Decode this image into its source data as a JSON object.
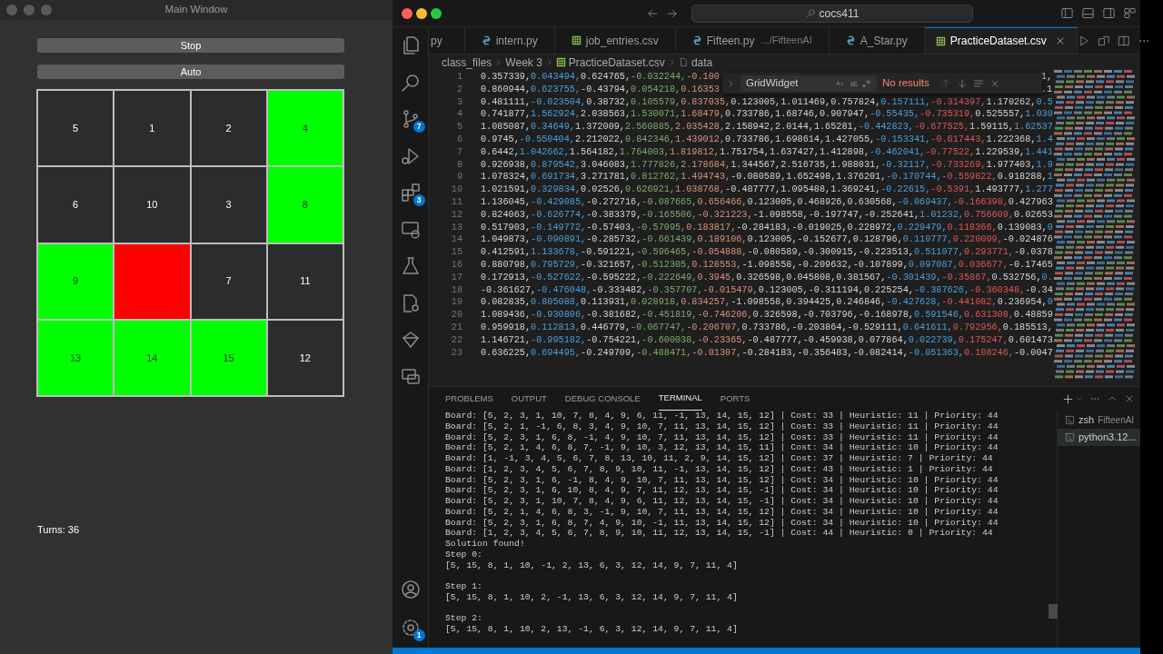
{
  "app_window": {
    "title": "Main Window",
    "buttons": [
      "Stop",
      "Auto"
    ],
    "tiles": [
      {
        "label": "5",
        "kind": "number"
      },
      {
        "label": "1",
        "kind": "number"
      },
      {
        "label": "2",
        "kind": "number"
      },
      {
        "label": "4",
        "kind": "correct"
      },
      {
        "label": "6",
        "kind": "number"
      },
      {
        "label": "10",
        "kind": "number"
      },
      {
        "label": "3",
        "kind": "number"
      },
      {
        "label": "8",
        "kind": "correct"
      },
      {
        "label": "9",
        "kind": "correct"
      },
      {
        "kind": "blank"
      },
      {
        "label": "7",
        "kind": "number"
      },
      {
        "label": "11",
        "kind": "number"
      },
      {
        "label": "13",
        "kind": "correct"
      },
      {
        "label": "14",
        "kind": "correct"
      },
      {
        "label": "15",
        "kind": "correct"
      },
      {
        "label": "12",
        "kind": "number"
      }
    ],
    "turns": "Turns: 36"
  },
  "editor_window": {
    "search": "cocs411",
    "activity_bar": {
      "source_control_badge": "7",
      "extensions_badge": "3",
      "manage_badge": "1"
    },
    "tabs": [
      {
        "label": "py",
        "kind": "cut",
        "selected": false
      },
      {
        "label": "intern.py",
        "kind": "python",
        "selected": false
      },
      {
        "label": "job_entries.csv",
        "kind": "csv",
        "selected": false
      },
      {
        "label": "Fifteen.py",
        "detail": ".../FifteenAI",
        "kind": "python",
        "selected": false
      },
      {
        "label": "A_Star.py",
        "kind": "python",
        "selected": false
      },
      {
        "label": "PracticeDataset.csv",
        "kind": "csv",
        "selected": true
      }
    ],
    "breadcrumb": [
      "class_files",
      "Week 3",
      "PracticeDataset.csv",
      "data"
    ],
    "find": {
      "value": "GridWidget",
      "result": "No results"
    },
    "lines": [
      {
        "number": "1",
        "text": "0.357339,0.043494,0.624765,-0.032244,-0.100",
        "tail": "1,"
      },
      {
        "number": "2",
        "text": "0.860944,0.623755,-0.43794,0.054218,0.16353",
        "tail": ".1"
      },
      {
        "number": "3",
        "text": "0.481111,-0.023504,0.38732,0.105579,0.837035,0.123005,1.011469,0.757824,0.157111,-0.314397,1.170262,0.5"
      },
      {
        "number": "4",
        "text": "0.741877,1.562924,2.038563,1.530071,1.68479,0.733786,1.68746,0.907947,-0.55435,-0.735319,0.525557,1.030"
      },
      {
        "number": "5",
        "text": "1.085087,0.34649,1.372009,2.560885,2.035428,2.158942,2.0144,1.65281,-0.442823,-0.677525,1.59115,1.62537"
      },
      {
        "number": "6",
        "text": "0.9745,-0.550404,2.212022,0.842346,1.439012,0.733786,1.698614,1.427055,-0.153341,-0.617443,1.222368,1.4"
      },
      {
        "number": "7",
        "text": "0.6442,1.042662,1.564182,1.764003,1.819812,1.751754,1.637427,1.412898,-0.462041,-0.77522,1.229539,1.441"
      },
      {
        "number": "8",
        "text": "0.926938,0.879542,3.046083,1.777826,2.178684,1.344567,2.516735,1.988031,-0.32117,-0.733269,1.977403,1.9"
      },
      {
        "number": "9",
        "text": "1.078324,0.691734,3.271781,0.812762,1.494743,-0.080589,1.652498,1.376201,-0.170744,-0.559822,0.918288,1"
      },
      {
        "number": "10",
        "text": "1.021591,0.329834,0.02526,0.626921,1.038768,-0.487777,1.095488,1.369241,-0.22615,-0.5391,1.493777,1.277"
      },
      {
        "number": "11",
        "text": "1.136045,-0.429085,-0.272716,-0.087665,0.656466,0.123005,0.468926,0.630568,-0.069437,-0.166398,0.427963"
      },
      {
        "number": "12",
        "text": "0.824063,-0.626774,-0.383379,-0.165506,-0.321223,-1.098558,-0.197747,-0.252641,1.01232,0.756609,0.02653"
      },
      {
        "number": "13",
        "text": "0.517903,-0.149772,-0.57403,-0.57095,0.183817,-0.284183,-0.019025,0.228972,0.229479,0.118366,0.139083,0"
      },
      {
        "number": "14",
        "text": "1.049873,-0.090891,-0.285732,-0.661439,0.189106,0.123005,-0.152677,0.128796,0.110777,0.220009,-0.024876"
      },
      {
        "number": "15",
        "text": "0.412591,1.133678,-0.591221,-0.596465,-0.054888,-0.080589,-0.300915,-0.223513,0.511077,0.293771,-0.0378"
      },
      {
        "number": "16",
        "text": "0.880798,0.795729,-0.321657,-0.512305,0.128553,-1.098558,-0.209632,-0.107899,0.097087,0.036677,-0.17465"
      },
      {
        "number": "17",
        "text": "0.172913,-0.527622,-0.595222,-0.222649,0.3945,0.326598,0.045808,0.381567,-0.301439,-0.35867,0.532756,0."
      },
      {
        "number": "18",
        "text": "-0.361627,-0.476048,-0.333482,-0.357707,-0.015479,0.123005,-0.311194,0.225254,-0.387626,-0.360348,-0.34"
      },
      {
        "number": "19",
        "text": "0.082835,0.805088,0.113931,0.028918,0.834257,-1.098558,0.394425,0.246846,-0.427628,-0.441082,0.236954,0"
      },
      {
        "number": "20",
        "text": "1.089436,-0.930806,-0.381682,-0.451819,-0.746206,0.326598,-0.703796,-0.168978,0.591546,0.631308,0.48859"
      },
      {
        "number": "21",
        "text": "0.959918,0.112813,0.446779,-0.067747,-0.206707,0.733786,-0.203864,-0.529111,0.641611,0.792956,0.185513,"
      },
      {
        "number": "22",
        "text": "1.146721,-0.995182,-0.754221,-0.600038,-0.23365,-0.487777,-0.459938,0.077864,0.022739,0.175247,0.601473"
      },
      {
        "number": "23",
        "text": "0.636225,0.694495,-0.249709,-0.488471,-0.01307,-0.284183,-0.356483,-0.082414,-0.051363,0.108246,-0.0047"
      }
    ],
    "panel_tabs": [
      {
        "label": "PROBLEMS",
        "selected": false
      },
      {
        "label": "OUTPUT",
        "selected": false
      },
      {
        "label": "DEBUG CONSOLE",
        "selected": false
      },
      {
        "label": "TERMINAL",
        "selected": true
      },
      {
        "label": "PORTS",
        "selected": false
      }
    ],
    "terminal_lines": [
      {
        "text": "Board: [5, 2, 3, 1, 10, 7, 8, 4, 9, 6, 11, -1, 13, 14, 15, 12] | Cost: 33 | Heuristic: 11 | Priority: 44"
      },
      {
        "text": "Board: [5, 2, 1, -1, 6, 8, 3, 4, 9, 10, 7, 11, 13, 14, 15, 12] | Cost: 33 | Heuristic: 11 | Priority: 44"
      },
      {
        "text": "Board: [5, 2, 3, 1, 6, 8, -1, 4, 9, 10, 7, 11, 13, 14, 15, 12] | Cost: 33 | Heuristic: 11 | Priority: 44"
      },
      {
        "text": "Board: [5, 2, 1, 4, 6, 8, 7, -1, 9, 10, 3, 12, 13, 14, 15, 11] | Cost: 34 | Heuristic: 10 | Priority: 44"
      },
      {
        "text": "Board: [1, -1, 3, 4, 5, 6, 7, 8, 13, 10, 11, 2, 9, 14, 15, 12] | Cost: 37 | Heuristic: 7 | Priority: 44"
      },
      {
        "text": "Board: [1, 2, 3, 4, 5, 6, 7, 8, 9, 10, 11, -1, 13, 14, 15, 12] | Cost: 43 | Heuristic: 1 | Priority: 44"
      },
      {
        "text": "Board: [5, 2, 3, 1, 6, -1, 8, 4, 9, 10, 7, 11, 13, 14, 15, 12] | Cost: 34 | Heuristic: 10 | Priority: 44"
      },
      {
        "text": "Board: [5, 2, 3, 1, 6, 10, 8, 4, 9, 7, 11, 12, 13, 14, 15, -1] | Cost: 34 | Heuristic: 10 | Priority: 44"
      },
      {
        "text": "Board: [5, 2, 3, 1, 10, 7, 8, 4, 9, 6, 11, 12, 13, 14, 15, -1] | Cost: 34 | Heuristic: 10 | Priority: 44"
      },
      {
        "text": "Board: [5, 2, 1, 4, 6, 8, 3, -1, 9, 10, 7, 11, 13, 14, 15, 12] | Cost: 34 | Heuristic: 10 | Priority: 44"
      },
      {
        "text": "Board: [5, 2, 3, 1, 6, 8, 7, 4, 9, 10, -1, 11, 13, 14, 15, 12] | Cost: 34 | Heuristic: 10 | Priority: 44"
      },
      {
        "text": "Board: [1, 2, 3, 4, 5, 6, 7, 8, 9, 10, 11, 12, 13, 14, 15, -1] | Cost: 44 | Heuristic: 0 | Priority: 44"
      },
      {
        "text": "Solution found!"
      },
      {
        "text": "Step 0:"
      },
      {
        "text": "[5, 15, 8, 1, 10, -1, 2, 13, 6, 3, 12, 14, 9, 7, 11, 4]"
      },
      {
        "text": "Step 1:",
        "gap_before": true
      },
      {
        "text": "[5, 15, 8, 1, 10, 2, -1, 13, 6, 3, 12, 14, 9, 7, 11, 4]"
      },
      {
        "text": "Step 2:",
        "gap_before": true
      },
      {
        "text": "[5, 15, 8, 1, 10, 2, 13, -1, 6, 3, 12, 14, 9, 7, 11, 4]"
      }
    ],
    "terminals": [
      {
        "name": "zsh",
        "detail": "FifteenAI",
        "selected": false
      },
      {
        "name": "python3.12...",
        "selected": true
      }
    ]
  }
}
